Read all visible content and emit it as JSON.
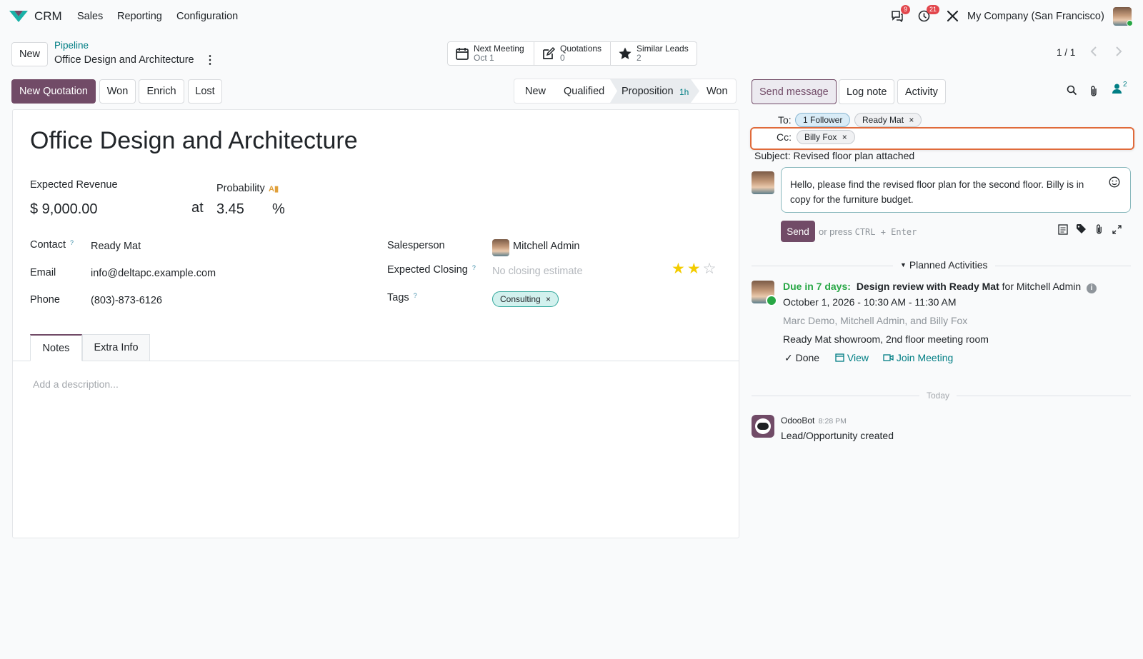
{
  "nav": {
    "app_name": "CRM",
    "menu": [
      "Sales",
      "Reporting",
      "Configuration"
    ],
    "messages_count": "9",
    "activities_count": "21",
    "company": "My Company (San Francisco)"
  },
  "control": {
    "new_label": "New",
    "breadcrumb_parent": "Pipeline",
    "breadcrumb_current": "Office Design and Architecture",
    "pager": "1 / 1",
    "smart_buttons": [
      {
        "label": "Next Meeting",
        "value": "Oct 1"
      },
      {
        "label": "Quotations",
        "value": "0"
      },
      {
        "label": "Similar Leads",
        "value": "2"
      }
    ]
  },
  "actions": {
    "new_quotation": "New Quotation",
    "won": "Won",
    "enrich": "Enrich",
    "lost": "Lost"
  },
  "stages": [
    {
      "label": "New"
    },
    {
      "label": "Qualified"
    },
    {
      "label": "Proposition",
      "badge": "1h"
    },
    {
      "label": "Won"
    }
  ],
  "form": {
    "title": "Office Design and Architecture",
    "expected_revenue_label": "Expected Revenue",
    "expected_revenue": "$ 9,000.00",
    "at": "at",
    "probability_label": "Probability",
    "probability": "3.45",
    "percent": "%",
    "contact_label": "Contact",
    "contact": "Ready Mat",
    "email_label": "Email",
    "email": "info@deltapc.example.com",
    "phone_label": "Phone",
    "phone": "(803)-873-6126",
    "salesperson_label": "Salesperson",
    "salesperson": "Mitchell Admin",
    "closing_label": "Expected Closing",
    "closing_placeholder": "No closing estimate",
    "tags_label": "Tags",
    "tag": "Consulting",
    "tabs": [
      "Notes",
      "Extra Info"
    ],
    "description_placeholder": "Add a description...",
    "priority_stars": 2
  },
  "chatter": {
    "send_message": "Send message",
    "log_note": "Log note",
    "activity": "Activity",
    "followers_count": "2",
    "to_label": "To:",
    "to_followers": "1 Follower",
    "to_partner": "Ready Mat",
    "cc_label": "Cc:",
    "cc_partner": "Billy Fox",
    "subject_label": "Subject:",
    "subject": "Revised floor plan attached",
    "body": "Hello, please find the revised floor plan for the second floor. Billy is in copy for the furniture budget.",
    "send_btn": "Send",
    "send_hint_prefix": "or press",
    "send_hint_keys": "CTRL + Enter",
    "planned_label": "Planned Activities",
    "activity_due": "Due in 7 days:",
    "activity_title": "Design review with Ready Mat",
    "activity_for": "for Mitchell Admin",
    "activity_date": "October 1, 2026 - 10:30 AM - 11:30 AM",
    "activity_attendees": "Marc Demo, Mitchell Admin, and Billy Fox",
    "activity_location": "Ready Mat showroom, 2nd floor meeting room",
    "done": "Done",
    "view": "View",
    "join": "Join Meeting",
    "today": "Today",
    "msg_author": "OdooBot",
    "msg_time": "8:28 PM",
    "msg_body": "Lead/Opportunity created"
  }
}
